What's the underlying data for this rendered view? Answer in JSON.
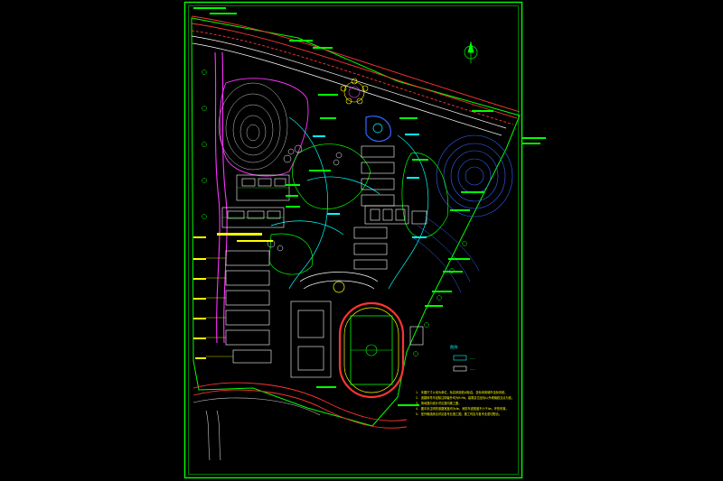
{
  "drawing": {
    "north_symbol": "north-arrow-icon",
    "legend_title": "图例",
    "legend_items": [
      "———",
      "———"
    ],
    "notes": [
      "1.  本图尺寸以米为单位，标高采用绝对标高，坐标采用城市坐标系统。",
      "2.  道路转弯半径除注明者外均为R=9m，建筑定位坐标以外墙轴线交点为准。",
      "3.  场地竖向设计详见竖向施工图。",
      "4.  图中未注明的道路宽度均为4m，消防车道宽度不小于4m，环形布置。",
      "5.  室外管线综合详见各专业施工图，施工时应与各专业密切配合。"
    ]
  },
  "colors": {
    "frame": "#00ff00",
    "road": "#ff3333",
    "building": "#ffffff",
    "label": "#00ff00",
    "accent": "#ffff00",
    "water": "#3366ff",
    "magenta": "#ff33ff",
    "cyan": "#00ffff"
  }
}
